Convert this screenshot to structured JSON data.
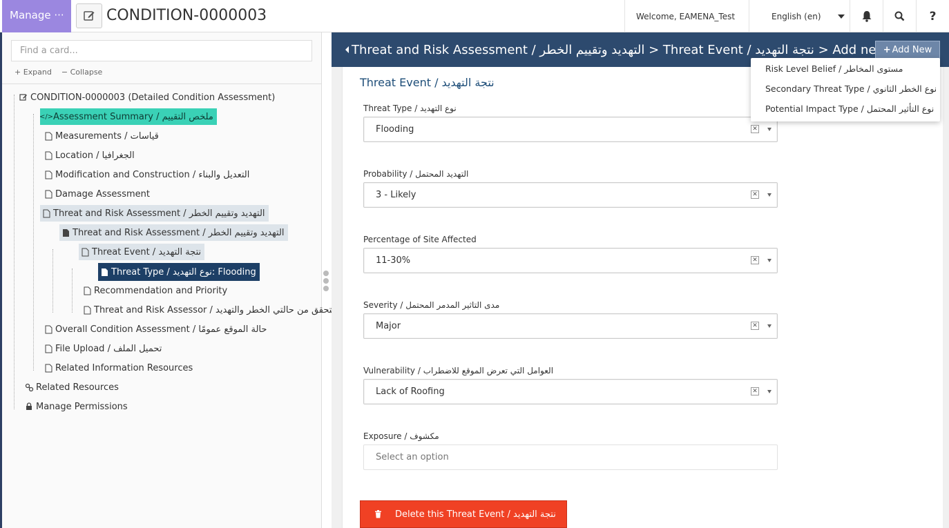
{
  "topbar": {
    "manage_label": "Manage",
    "manage_dots": "···",
    "page_title": "CONDITION-0000003",
    "welcome": "Welcome, EAMENA_Test",
    "language": "English (en)",
    "help": "?"
  },
  "sidebar": {
    "search_placeholder": "Find a card...",
    "expand": "Expand",
    "collapse": "Collapse",
    "nodes": [
      {
        "label": "CONDITION-0000003 (Detailed Condition Assessment)"
      },
      {
        "label": "Assessment Summary / ملخص التقييم"
      },
      {
        "label": "Measurements / قياسات"
      },
      {
        "label": "Location / الجغرافيا"
      },
      {
        "label": "Modification and Construction / التعديل والبناء"
      },
      {
        "label": "Damage Assessment"
      },
      {
        "label": "Threat and Risk Assessment / التهديد وتقييم الخطر"
      },
      {
        "label": "Threat and Risk Assessment / التهديد وتقييم الخطر"
      },
      {
        "label": "Threat Event / نتجة التهديد"
      },
      {
        "label": "Threat Type / نوع التهديد: Flooding"
      },
      {
        "label": "Recommendation and Priority"
      },
      {
        "label": "Threat and Risk Assessor / المتحقق من حالتي الخطر والتهديد"
      },
      {
        "label": "Overall Condition Assessment / حالة الموقع عمومًا"
      },
      {
        "label": "File Upload / تحميل الملف"
      },
      {
        "label": "Related Information Resources"
      },
      {
        "label": "Related Resources"
      },
      {
        "label": "Manage Permissions"
      }
    ]
  },
  "main": {
    "breadcrumb": "Threat and Risk Assessment / التهديد وتقييم الخطر > Threat Event / نتجة التهديد > Add new...",
    "add_new": "Add New",
    "card_title": "Threat Event / نتجة التهديد",
    "fields": [
      {
        "label": "Threat Type / نوع التهديد",
        "value": "Flooding"
      },
      {
        "label": "Probability / التهديد المحتمل",
        "value": "3 - Likely"
      },
      {
        "label": "Percentage of Site Affected",
        "value": "11-30%"
      },
      {
        "label": "Severity / مدى التاثير المدمر المحتمل",
        "value": "Major"
      },
      {
        "label": "Vulnerability / العوامل التي تعرض الموقع للاضطراب",
        "value": "Lack of Roofing"
      },
      {
        "label": "Exposure / مكشوف",
        "value": "Select an option"
      }
    ],
    "delete_label": "Delete this Threat Event / نتجة التهديد"
  },
  "dropdown": {
    "items": [
      "Risk Level Belief / مستوى المخاطر",
      "Secondary Threat Type / نوع الخطر الثانوي",
      "Potential Impact Type / نوع التأثير المحتمل"
    ]
  },
  "colors": {
    "manage": "#9b87e0",
    "header": "#2d4a6e",
    "teal_highlight": "#3ad1b6",
    "navy_highlight": "#1d3f66",
    "delete": "#f04124"
  }
}
